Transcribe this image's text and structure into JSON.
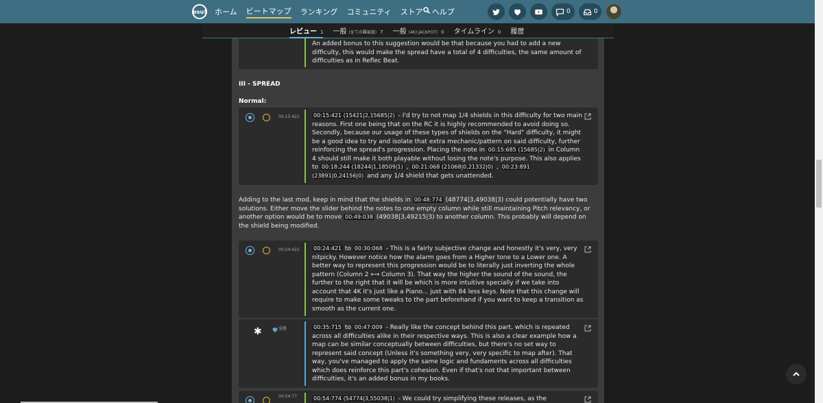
{
  "nav": {
    "logo": "osu!",
    "links": [
      "ホーム",
      "ビートマップ",
      "ランキング",
      "コミュニティ",
      "ストア",
      "ヘルプ"
    ],
    "chat_count": "0",
    "notif_count": "0"
  },
  "tabs": [
    {
      "label": "レビュー",
      "sub": "",
      "count": "1"
    },
    {
      "label": "一般",
      "sub": "(全ての難易度)",
      "count": "7"
    },
    {
      "label": "一般",
      "sub": "(4K) JACKPOT)",
      "count": "0"
    },
    {
      "label": "タイムライン",
      "sub": "",
      "count": "0"
    },
    {
      "label": "履歴",
      "sub": "",
      "count": ""
    }
  ],
  "post0": {
    "text": "An added bonus to this suggestion would be that because you had to add a new difficulty, this would make the spread have a total of 4 difficulties, the same amount of difficulties as in Reflec Beat."
  },
  "section_heading": "III - SPREAD",
  "normal_label": "Normal:",
  "post1": {
    "timestamp": "00:15:421",
    "tag1": "00:15:421 (15421|2,15685|2)",
    "t1": " - I'd try to not map 1/4 shields in this difficulty for two main reasons. First one being that on the RC it is highly recommended to avoid doing so. Secondly, because our usage of these types of shields on the \"Hard\" difficulty, it might be a good idea to try and isolate that extra mechanic/pattern on said difficulty, further reinforcing the spread's progression. Placing the note in ",
    "tag2": "00:15:685 (15685|2)",
    "t2": " in Column 4 should still make it both playable without losing the note's purpose. This also applies to ",
    "tag3": "00:18:244 (18244|1,18509|1)",
    "sep1": " , ",
    "tag4": "00:21:068 (21068|0,21332|0)",
    "sep2": " , ",
    "tag5": "00:23:891 (23891|0,24156|0)",
    "t3": " and any 1/4 shield that gets unattended."
  },
  "para1": {
    "t1": "Adding to the last mod, keep in mind that the shields in ",
    "tag1": "00:48:774",
    "t2": " (48774|3,49038|3) could potentially have two solutions. Either move the slider behind the notes to one empty column while still maintaining Pitch relevancy, or another option would be to move ",
    "tag2": "00:49:038",
    "t3": " (49038|3,49215|3) to another column. This probably will depend on the shield being modified."
  },
  "post2": {
    "timestamp": "00:24:421",
    "tag1": "00:24:421",
    "to": " to ",
    "tag2": "00:30:068",
    "text": " - This is a fairly subjective change and honestly it's very, very nitpicky. However notice how the alarm goes from a Higher tone to a Lower one. A better way to represent this progression would be to literally just inverting the whole pattern (Column 2 ⟷ Column 3). That way the higher the sound of the sound, the further to the right that it will be which is more intuitive specially if we take into account that 4K it's just like a Piano... just with 84 less keys. Note that this change will require to make some tweaks to the part beforehand if you want to keep a transition as smooth as the current one."
  },
  "post3": {
    "scope": "全般",
    "tag1": "00:35:715",
    "to": " to ",
    "tag2": "00:47:009",
    "text": " - Really like the concept behind this part, which is repeated across all difficulties alike in their respective ways. This is also a clear example how a map can be similar conceptually between difficulties, but there's no set way to represent said concept (Unless it's something very, very specific to map after). That way, you've managed to apply the same logic and fundaments across all difficulties which does reinforce this part's cohesion. Even if that's not that important between difficulties, it's an added bonus in my books."
  },
  "post4": {
    "timestamp": "00:54:77",
    "tag1": "00:54:774 (54774|3,55038|1)",
    "text": " - We could try simplifying these releases, as the coordination"
  },
  "colors": {
    "nav": "#3d6e82",
    "praise_bar": "#86c54a",
    "general_bar": "#5aa8d6",
    "suggestion_icon": "#e2b644"
  }
}
